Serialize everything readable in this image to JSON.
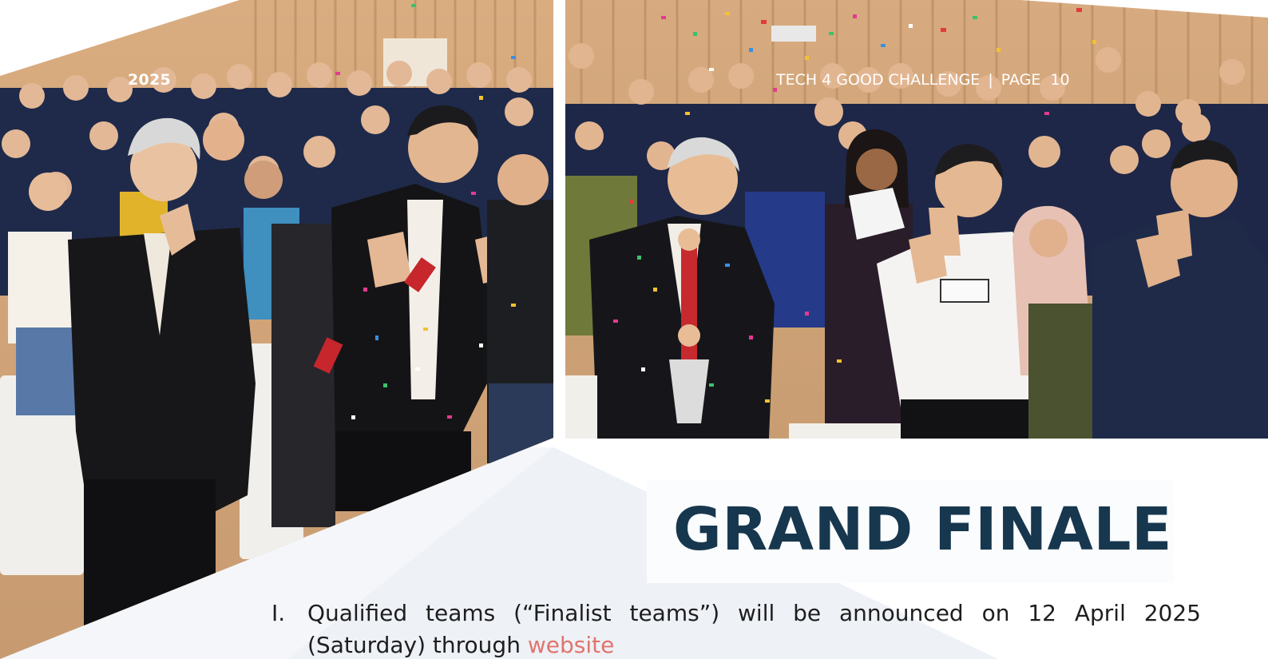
{
  "header": {
    "year": "2025",
    "title": "TECH 4 GOOD CHALLENGE",
    "separator": "|",
    "page_label": "PAGE",
    "page_number": "10"
  },
  "section_title": "GRAND FINALE",
  "list": [
    {
      "number": "I.",
      "text_before": "Qualified teams (“Finalist teams”) will be announced on 12 April 2025 (Saturday) through ",
      "link_text": "website"
    }
  ],
  "colors": {
    "title": "#17374f",
    "link": "#e0756e",
    "body_text": "#1e1e1e"
  }
}
